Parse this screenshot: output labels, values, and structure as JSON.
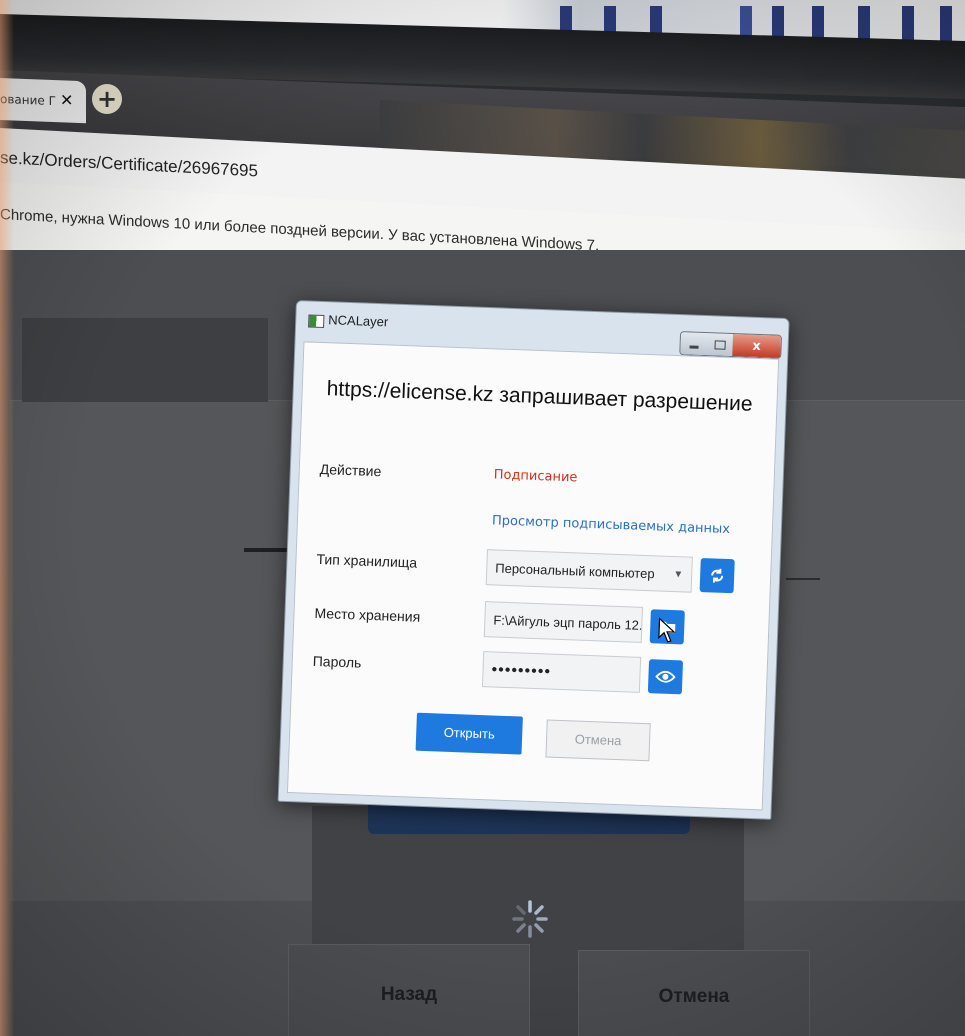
{
  "browser": {
    "tab_title": "ование Г",
    "tab_close_glyph": "✕",
    "new_tab_glyph": "+",
    "url": "se.kz/Orders/Certificate/26967695",
    "infobar_message": "Chrome, нужна Windows 10 или более поздней версии. У вас установлена Windows 7."
  },
  "page": {
    "back_button_label": "Назад",
    "cancel_button_label": "Отмена"
  },
  "dialog": {
    "title": "NCALayer",
    "close_glyph": "x",
    "heading": "https://elicense.kz запрашивает разрешение",
    "action_label": "Действие",
    "action_value": "Подписание",
    "preview_link": "Просмотр подписываемых данных",
    "storage_type_label": "Тип хранилища",
    "storage_type_value": "Персональный компьютер",
    "storage_location_label": "Место хранения",
    "storage_location_value": "F:\\Айгуль эцп пароль 12.",
    "password_label": "Пароль",
    "password_value": "•••••••••",
    "open_button_label": "Открыть",
    "cancel_button_label": "Отмена"
  },
  "colors": {
    "accent_blue": "#1f7ae0",
    "action_red": "#d0311f",
    "link_blue": "#2a6fc5",
    "close_red": "#c33b26"
  },
  "icons": {
    "refresh": "refresh-icon",
    "folder": "folder-icon",
    "eye": "eye-icon",
    "spinner": "loading-spinner-icon"
  }
}
